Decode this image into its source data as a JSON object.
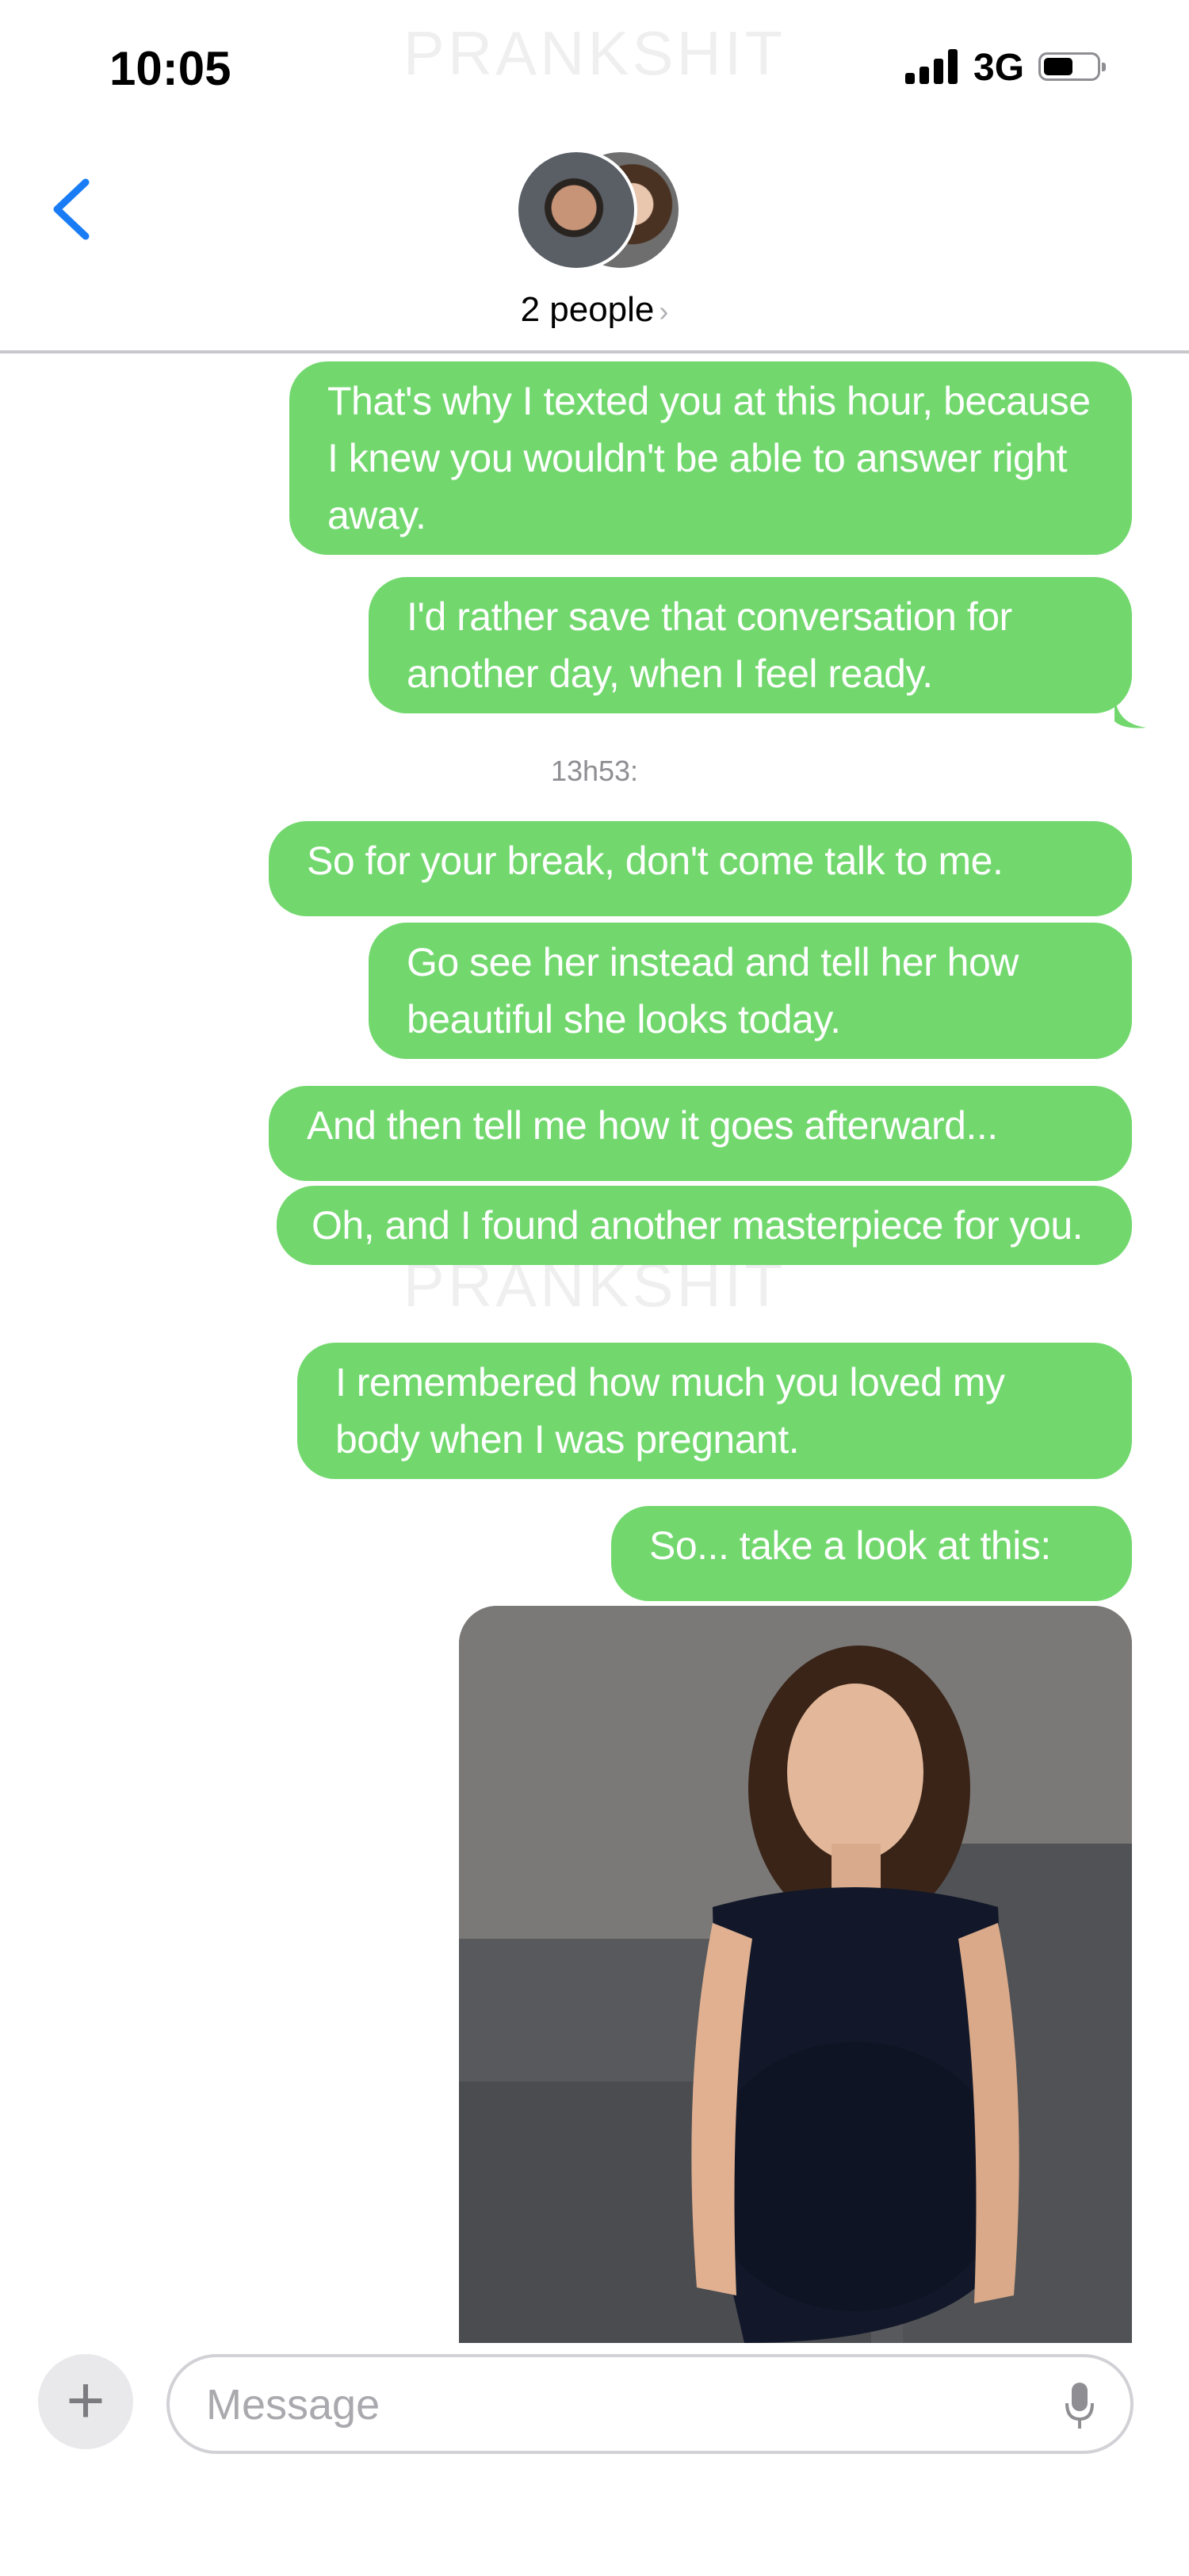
{
  "status_bar": {
    "time": "10:05",
    "network": "3G"
  },
  "watermark": "PRANKSHIT",
  "header": {
    "title": "2 people",
    "chevron": "›"
  },
  "messages": [
    "That's why I texted you at this hour, because I knew you wouldn't be able to answer right away.",
    "I'd rather save that conversation for another day, when I feel ready.",
    "So for your break, don't come talk to me.",
    "Go see her instead and tell her how beautiful she looks today.",
    "And then tell me how it goes afterward...",
    "Oh, and I found another masterpiece for you.",
    "I remembered how much you loved my body when I was pregnant.",
    "So... take a look at this:"
  ],
  "timestamp": "13h53:",
  "input": {
    "placeholder": "Message",
    "plus_label": "+"
  },
  "colors": {
    "bubble": "#72d86e",
    "accent": "#1a7cf5",
    "divider": "#c8c8cc"
  },
  "icons": {
    "back": "chevron-left-icon",
    "plus": "plus-icon",
    "mic": "microphone-icon"
  }
}
